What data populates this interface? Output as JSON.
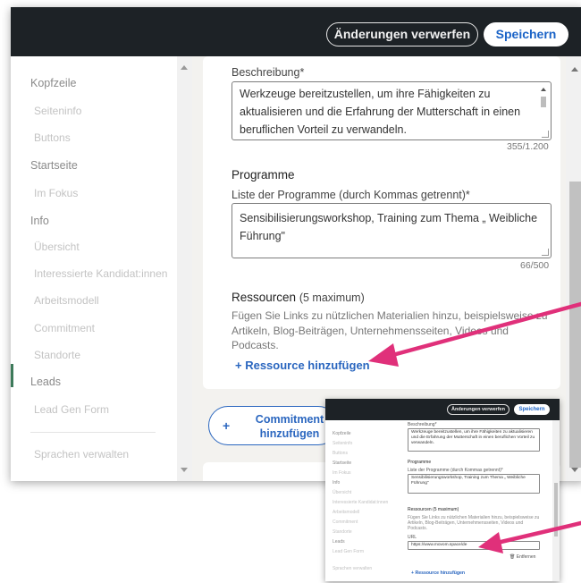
{
  "header": {
    "discard_label": "Änderungen verwerfen",
    "save_label": "Speichern"
  },
  "sidebar": {
    "sections": [
      {
        "title": "Kopfzeile",
        "items": [
          "Seiteninfo",
          "Buttons"
        ]
      },
      {
        "title": "Startseite",
        "items": [
          "Im Fokus"
        ]
      },
      {
        "title": "Info",
        "items": [
          "Übersicht",
          "Interessierte Kandidat:innen",
          "Arbeitsmodell",
          "Commitment",
          "Standorte"
        ]
      },
      {
        "title": "Leads",
        "items": [
          "Lead Gen Form"
        ]
      }
    ],
    "footer_item": "Sprachen verwalten",
    "active_item": "Commitment"
  },
  "description": {
    "label": "Beschreibung*",
    "text": "Werkzeuge bereitzustellen, um ihre Fähigkeiten zu aktualisieren und die Erfahrung der Mutterschaft in einen beruflichen Vorteil zu verwandeln.",
    "counter": "355/1.200"
  },
  "programs": {
    "title": "Programme",
    "label": "Liste der Programme (durch Kommas getrennt)*",
    "value": "Sensibilisierungsworkshop, Training zum Thema „ Weibliche Führung\"",
    "counter": "66/500"
  },
  "resources": {
    "title": "Ressourcen",
    "title_suffix": "(5 maximum)",
    "description": "Fügen Sie Links zu nützlichen Materialien hinzu, beispielsweise zu Artikeln, Blog-Beiträgen, Unternehmensseiten, Videos und Podcasts.",
    "add_label": "+ Ressource hinzufügen"
  },
  "commitment_button": {
    "plus": "+",
    "label": "Commitment hinzufügen"
  },
  "mini_screenshot": {
    "url_label": "URL",
    "url_value": "https://www.movom.space/de",
    "remove_label": "Entfernen",
    "add_label": "+ Ressource hinzufügen",
    "resources_title": "Ressourcen (5 maximum)",
    "resources_desc": "Fügen Sie Links zu nützlichen Materialien hinzu, beispielsweise zu Artikeln, Blog-Beiträgen, Unternehmensseiten, Videos und Podcasts."
  },
  "colors": {
    "topbar": "#1d2226",
    "accent": "#2a66bf",
    "arrow": "#e0307a"
  }
}
